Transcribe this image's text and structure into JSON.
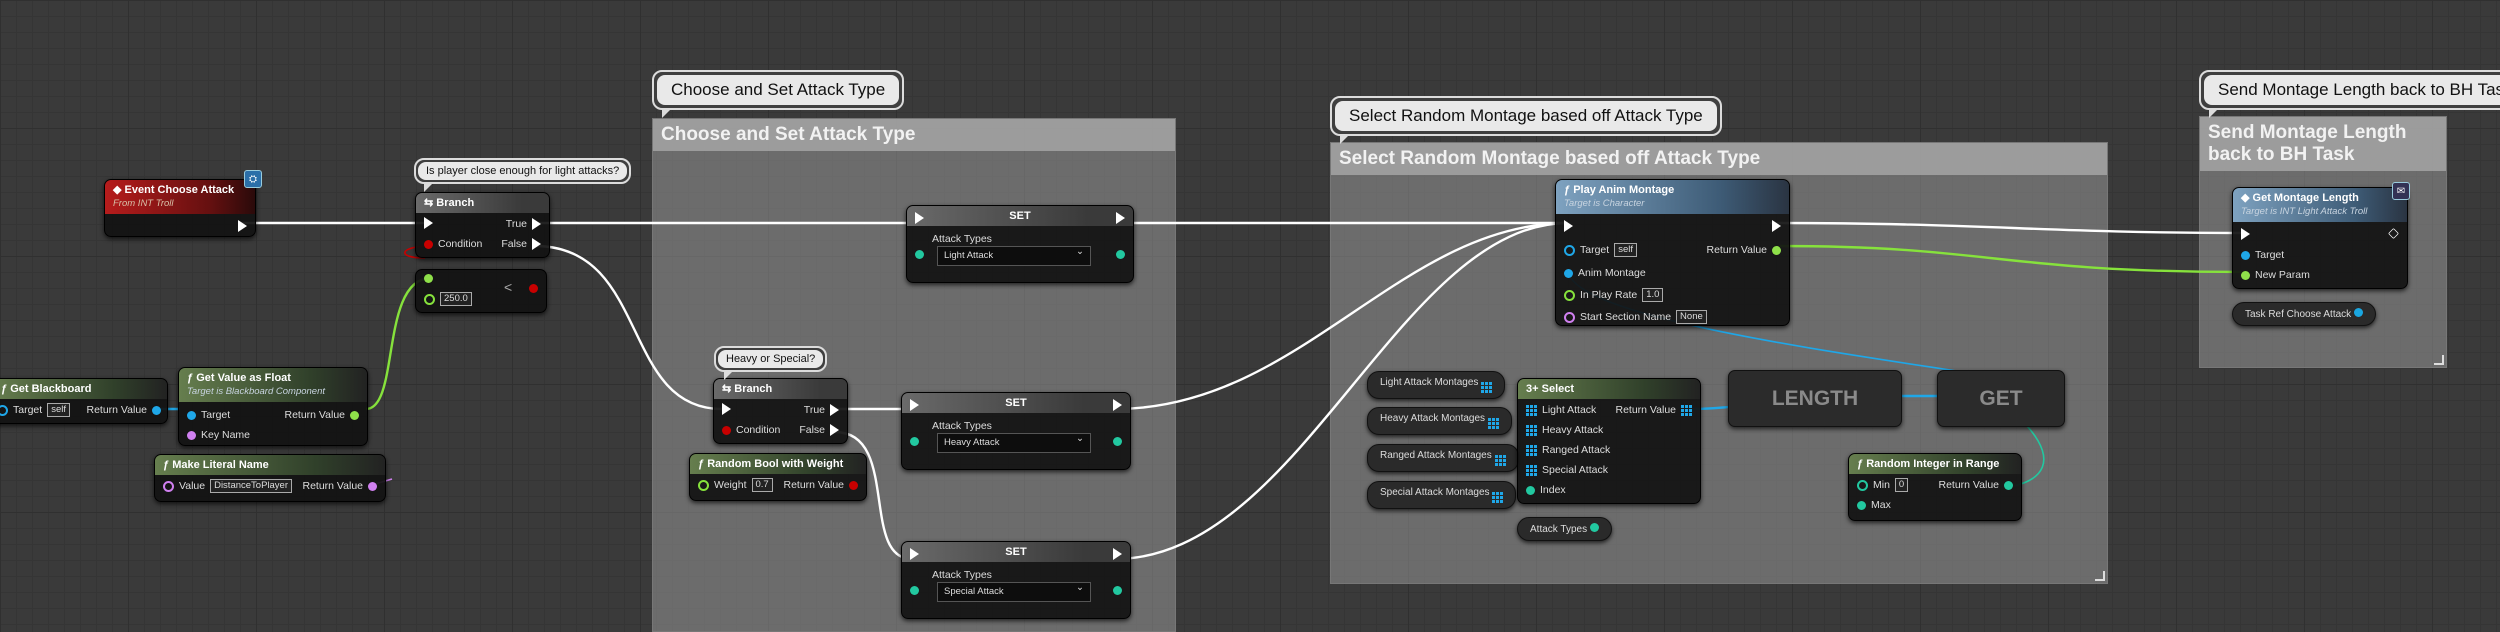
{
  "comments": {
    "choose_set": {
      "title": "Choose and Set Attack Type",
      "bubble": "Choose and Set Attack Type"
    },
    "select_montage": {
      "title": "Select Random Montage based off Attack Type",
      "bubble": "Select Random Montage based off Attack Type"
    },
    "send_length": {
      "title": "Send Montage Length back to BH Task",
      "bubble": "Send Montage Length back to BH Task"
    },
    "player_close": {
      "bubble": "Is player close enough for light attacks?"
    },
    "heavy_special": {
      "bubble": "Heavy or Special?"
    }
  },
  "nodes": {
    "event": {
      "title": "Event Choose Attack",
      "subtitle": "From INT Troll"
    },
    "branch1": {
      "title": "Branch",
      "true": "True",
      "false": "False",
      "condition": "Condition"
    },
    "compare": {
      "value": "250.0"
    },
    "get_blackboard": {
      "title": "Get Blackboard",
      "target": "Target",
      "target_value": "self",
      "return": "Return Value"
    },
    "get_value_float": {
      "title": "Get Value as Float",
      "subtitle": "Target is Blackboard Component",
      "target": "Target",
      "key": "Key Name",
      "return": "Return Value"
    },
    "make_literal": {
      "title": "Make Literal Name",
      "value_label": "Value",
      "value": "DistanceToPlayer",
      "return": "Return Value"
    },
    "set1": {
      "title": "SET",
      "label": "Attack Types",
      "value": "Light Attack"
    },
    "set2": {
      "title": "SET",
      "label": "Attack Types",
      "value": "Heavy Attack"
    },
    "set3": {
      "title": "SET",
      "label": "Attack Types",
      "value": "Special Attack"
    },
    "branch2": {
      "title": "Branch",
      "true": "True",
      "false": "False",
      "condition": "Condition"
    },
    "random_bool": {
      "title": "Random Bool with Weight",
      "weight_label": "Weight",
      "weight": "0.7",
      "return": "Return Value"
    },
    "play_anim": {
      "title": "Play Anim Montage",
      "subtitle": "Target is Character",
      "target": "Target",
      "target_value": "self",
      "anim": "Anim Montage",
      "rate": "In Play Rate",
      "rate_value": "1.0",
      "section": "Start Section Name",
      "section_value": "None",
      "return": "Return Value"
    },
    "select": {
      "title": "Select",
      "light": "Light Attack",
      "heavy": "Heavy Attack",
      "ranged": "Ranged Attack",
      "special": "Special Attack",
      "index": "Index",
      "return": "Return Value"
    },
    "light_montages": {
      "label": "Light Attack Montages"
    },
    "heavy_montages": {
      "label": "Heavy Attack Montages"
    },
    "ranged_montages": {
      "label": "Ranged Attack Montages"
    },
    "special_montages": {
      "label": "Special Attack Montages"
    },
    "attack_types_var": {
      "label": "Attack Types"
    },
    "length": {
      "label": "LENGTH"
    },
    "get": {
      "label": "GET"
    },
    "random_int": {
      "title": "Random Integer in Range",
      "min": "Min",
      "min_value": "0",
      "max": "Max",
      "return": "Return Value"
    },
    "get_montage_length": {
      "title": "Get Montage Length",
      "subtitle": "Target is INT Light Attack Troll",
      "target": "Target",
      "param": "New Param"
    },
    "task_ref": {
      "label": "Task Ref Choose Attack"
    }
  },
  "colors": {
    "exec": "#ffffff",
    "object": "#1fa7e8",
    "float": "#86e23c",
    "bool": "#c80000",
    "name": "#d080f0",
    "int": "#22c8a0"
  }
}
